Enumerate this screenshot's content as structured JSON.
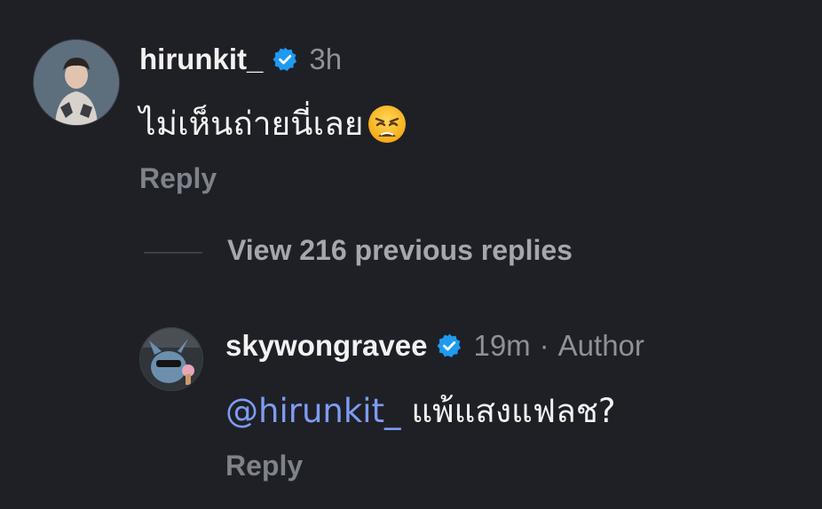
{
  "comments": [
    {
      "username": "hirunkit_",
      "verified": true,
      "time": "3h",
      "text": "ไม่เห็นถ่ายนี่เลย",
      "emoji": "weary-face",
      "reply_label": "Reply"
    }
  ],
  "thread": {
    "view_replies_label": "View 216 previous replies"
  },
  "reply": {
    "username": "skywongravee",
    "verified": true,
    "time": "19m",
    "separator": "·",
    "author_badge": "Author",
    "mention": "@hirunkit_",
    "text": " แพ้แสงแฟลช?",
    "reply_label": "Reply"
  },
  "colors": {
    "background": "#1f2026",
    "verified_badge": "#1d9bf0",
    "mention": "#7d9cf2",
    "muted": "#8e9199"
  }
}
